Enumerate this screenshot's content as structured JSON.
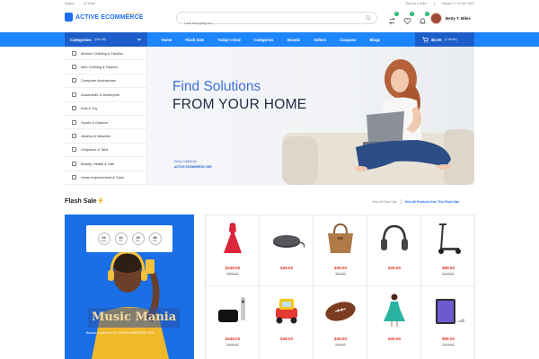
{
  "topbar": {
    "language": "English",
    "currency": "US Dollar",
    "seller": "Become a Seller",
    "helpline": "Helpline +1 234 567 8900"
  },
  "header": {
    "logo_text": "ACTIVE ECOMMERCE",
    "logo_sub": "Multi-Vendor",
    "search_placeholder": "I am shopping for...",
    "compare_count": "0",
    "wishlist_count": "0",
    "notification_count": "0",
    "user_name": "Betty T. Miles"
  },
  "nav": {
    "categories_label": "Categories",
    "categories_all": "(See All)",
    "links": [
      "Home",
      "Flash Sale",
      "Today's Deal",
      "Categories",
      "Brands",
      "Sellers",
      "Coupons",
      "Blogs"
    ],
    "cart_amount": "$0.00",
    "cart_items": "(0 Items)"
  },
  "categories": [
    "Women Clothing & Fashion",
    "Men Clothing & Fashion",
    "Computer Accessories",
    "Automobile & Motorcycle",
    "Kids & Toy",
    "Sports & Outdoor",
    "Jewelry & Watches",
    "Cellphone & Tabs",
    "Beauty, Health & Hair",
    "Home Improvement & Tools"
  ],
  "hero": {
    "line1": "Find Solutions",
    "line2": "FROM YOUR HOME",
    "small1": "Demo Content for",
    "small2": "ACTIVE ECOMMERCE CMS"
  },
  "flash": {
    "title": "Flash Sale",
    "link_all": "View All Flash Sale",
    "link_products": "View All Products from This Flash Sale",
    "timer": [
      {
        "n": "04",
        "u": "Days"
      },
      {
        "n": "14",
        "u": "Hrs"
      },
      {
        "n": "19",
        "u": "Min"
      },
      {
        "n": "48",
        "u": "Sec"
      }
    ],
    "promo_title": "Music Mania",
    "promo_sub": "Banner content for ACTIVE ECOMMERCE CMS"
  },
  "products": [
    {
      "icon": "dress",
      "price": "$449.00",
      "old": "$499.00"
    },
    {
      "icon": "wireless-charger",
      "price": "$49.00",
      "old": ""
    },
    {
      "icon": "handbag",
      "price": "$39.00",
      "old": "$49.00"
    },
    {
      "icon": "headphones",
      "price": "$39.00",
      "old": ""
    },
    {
      "icon": "scooter",
      "price": "$99.00",
      "old": "$119.00"
    },
    {
      "icon": "apple-tv",
      "price": "$449.00",
      "old": "$499.00"
    },
    {
      "icon": "toy-car",
      "price": "$49.00",
      "old": ""
    },
    {
      "icon": "football",
      "price": "$39.00",
      "old": "$49.00"
    },
    {
      "icon": "woman-dress",
      "price": "$39.00",
      "old": ""
    },
    {
      "icon": "tablet",
      "price": "$99.00",
      "old": "$119.00"
    }
  ],
  "colors": {
    "primary": "#1d85ff",
    "primary_dark": "#1c5ec9",
    "sale_price": "#e0342b"
  }
}
